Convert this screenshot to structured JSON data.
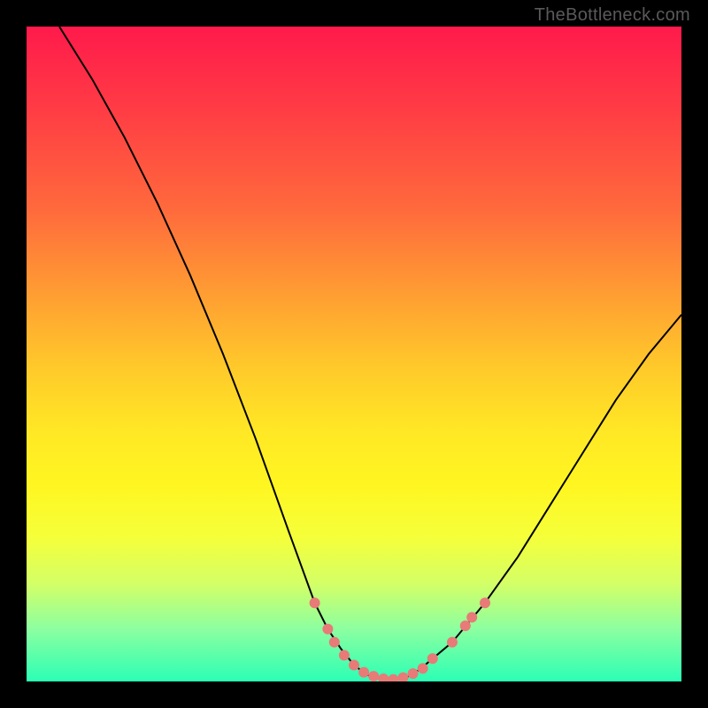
{
  "watermark": "TheBottleneck.com",
  "chart_data": {
    "type": "line",
    "title": "",
    "xlabel": "",
    "ylabel": "",
    "xlim": [
      0,
      100
    ],
    "ylim": [
      0,
      100
    ],
    "grid": false,
    "legend": false,
    "series": [
      {
        "name": "curve",
        "x": [
          5,
          10,
          15,
          20,
          25,
          30,
          35,
          40,
          44,
          46,
          48,
          50,
          52,
          54,
          56,
          58,
          60,
          65,
          70,
          75,
          80,
          85,
          90,
          95,
          100
        ],
        "y": [
          100,
          92,
          83,
          73,
          62,
          50,
          37,
          23,
          12,
          8,
          5,
          2.5,
          1,
          0.4,
          0.2,
          0.6,
          1.8,
          6,
          12,
          19,
          27,
          35,
          43,
          50,
          56
        ]
      }
    ],
    "markers": [
      {
        "x": 44.0,
        "y": 12.0
      },
      {
        "x": 46.0,
        "y": 8.0
      },
      {
        "x": 47.0,
        "y": 6.0
      },
      {
        "x": 48.5,
        "y": 4.0
      },
      {
        "x": 50.0,
        "y": 2.5
      },
      {
        "x": 51.5,
        "y": 1.4
      },
      {
        "x": 53.0,
        "y": 0.8
      },
      {
        "x": 54.5,
        "y": 0.4
      },
      {
        "x": 56.0,
        "y": 0.3
      },
      {
        "x": 57.5,
        "y": 0.6
      },
      {
        "x": 59.0,
        "y": 1.2
      },
      {
        "x": 60.5,
        "y": 2.0
      },
      {
        "x": 62.0,
        "y": 3.5
      },
      {
        "x": 65.0,
        "y": 6.0
      },
      {
        "x": 67.0,
        "y": 8.5
      },
      {
        "x": 68.0,
        "y": 9.8
      },
      {
        "x": 70.0,
        "y": 12.0
      }
    ],
    "background_gradient": {
      "top": "#ff1a4b",
      "mid": "#ffe825",
      "bottom": "#2bffb5"
    }
  }
}
